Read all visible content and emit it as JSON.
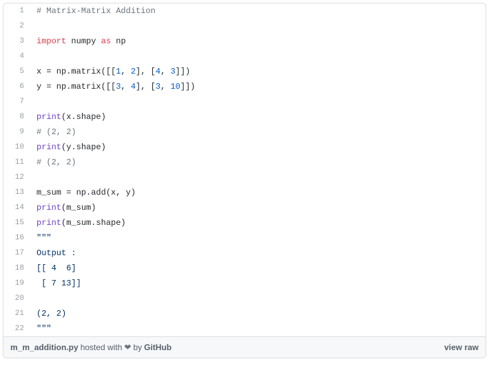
{
  "code": {
    "lines": [
      {
        "n": "1",
        "seg": [
          {
            "t": "# Matrix-Matrix Addition",
            "c": "pl-c"
          }
        ]
      },
      {
        "n": "2",
        "seg": []
      },
      {
        "n": "3",
        "seg": [
          {
            "t": "import",
            "c": "pl-k"
          },
          {
            "t": " numpy ",
            "c": ""
          },
          {
            "t": "as",
            "c": "pl-k"
          },
          {
            "t": " np",
            "c": ""
          }
        ]
      },
      {
        "n": "4",
        "seg": []
      },
      {
        "n": "5",
        "seg": [
          {
            "t": "x = np.matrix([[",
            "c": ""
          },
          {
            "t": "1",
            "c": "pl-c1"
          },
          {
            "t": ", ",
            "c": ""
          },
          {
            "t": "2",
            "c": "pl-c1"
          },
          {
            "t": "], [",
            "c": ""
          },
          {
            "t": "4",
            "c": "pl-c1"
          },
          {
            "t": ", ",
            "c": ""
          },
          {
            "t": "3",
            "c": "pl-c1"
          },
          {
            "t": "]])",
            "c": ""
          }
        ]
      },
      {
        "n": "6",
        "seg": [
          {
            "t": "y = np.matrix([[",
            "c": ""
          },
          {
            "t": "3",
            "c": "pl-c1"
          },
          {
            "t": ", ",
            "c": ""
          },
          {
            "t": "4",
            "c": "pl-c1"
          },
          {
            "t": "], [",
            "c": ""
          },
          {
            "t": "3",
            "c": "pl-c1"
          },
          {
            "t": ", ",
            "c": ""
          },
          {
            "t": "10",
            "c": "pl-c1"
          },
          {
            "t": "]])",
            "c": ""
          }
        ]
      },
      {
        "n": "7",
        "seg": []
      },
      {
        "n": "8",
        "seg": [
          {
            "t": "print",
            "c": "pl-en"
          },
          {
            "t": "(x.shape)",
            "c": ""
          }
        ]
      },
      {
        "n": "9",
        "seg": [
          {
            "t": "# (2, 2)",
            "c": "pl-c"
          }
        ]
      },
      {
        "n": "10",
        "seg": [
          {
            "t": "print",
            "c": "pl-en"
          },
          {
            "t": "(y.shape)",
            "c": ""
          }
        ]
      },
      {
        "n": "11",
        "seg": [
          {
            "t": "# (2, 2)",
            "c": "pl-c"
          }
        ]
      },
      {
        "n": "12",
        "seg": []
      },
      {
        "n": "13",
        "seg": [
          {
            "t": "m_sum = np.add(x, y)",
            "c": ""
          }
        ]
      },
      {
        "n": "14",
        "seg": [
          {
            "t": "print",
            "c": "pl-en"
          },
          {
            "t": "(m_sum)",
            "c": ""
          }
        ]
      },
      {
        "n": "15",
        "seg": [
          {
            "t": "print",
            "c": "pl-en"
          },
          {
            "t": "(m_sum.shape)",
            "c": ""
          }
        ]
      },
      {
        "n": "16",
        "seg": [
          {
            "t": "\"\"\"",
            "c": "pl-s"
          }
        ]
      },
      {
        "n": "17",
        "seg": [
          {
            "t": "Output :",
            "c": "pl-s"
          }
        ]
      },
      {
        "n": "18",
        "seg": [
          {
            "t": "[[ 4  6]",
            "c": "pl-s"
          }
        ]
      },
      {
        "n": "19",
        "seg": [
          {
            "t": " [ 7 13]]",
            "c": "pl-s"
          }
        ]
      },
      {
        "n": "20",
        "seg": []
      },
      {
        "n": "21",
        "seg": [
          {
            "t": "(2, 2)",
            "c": "pl-s"
          }
        ]
      },
      {
        "n": "22",
        "seg": [
          {
            "t": "\"\"\"",
            "c": "pl-s"
          }
        ]
      }
    ]
  },
  "footer": {
    "filename": "m_m_addition.py",
    "hosted_with": " hosted with ",
    "by": " by ",
    "github": "GitHub",
    "view_raw": "view raw"
  }
}
